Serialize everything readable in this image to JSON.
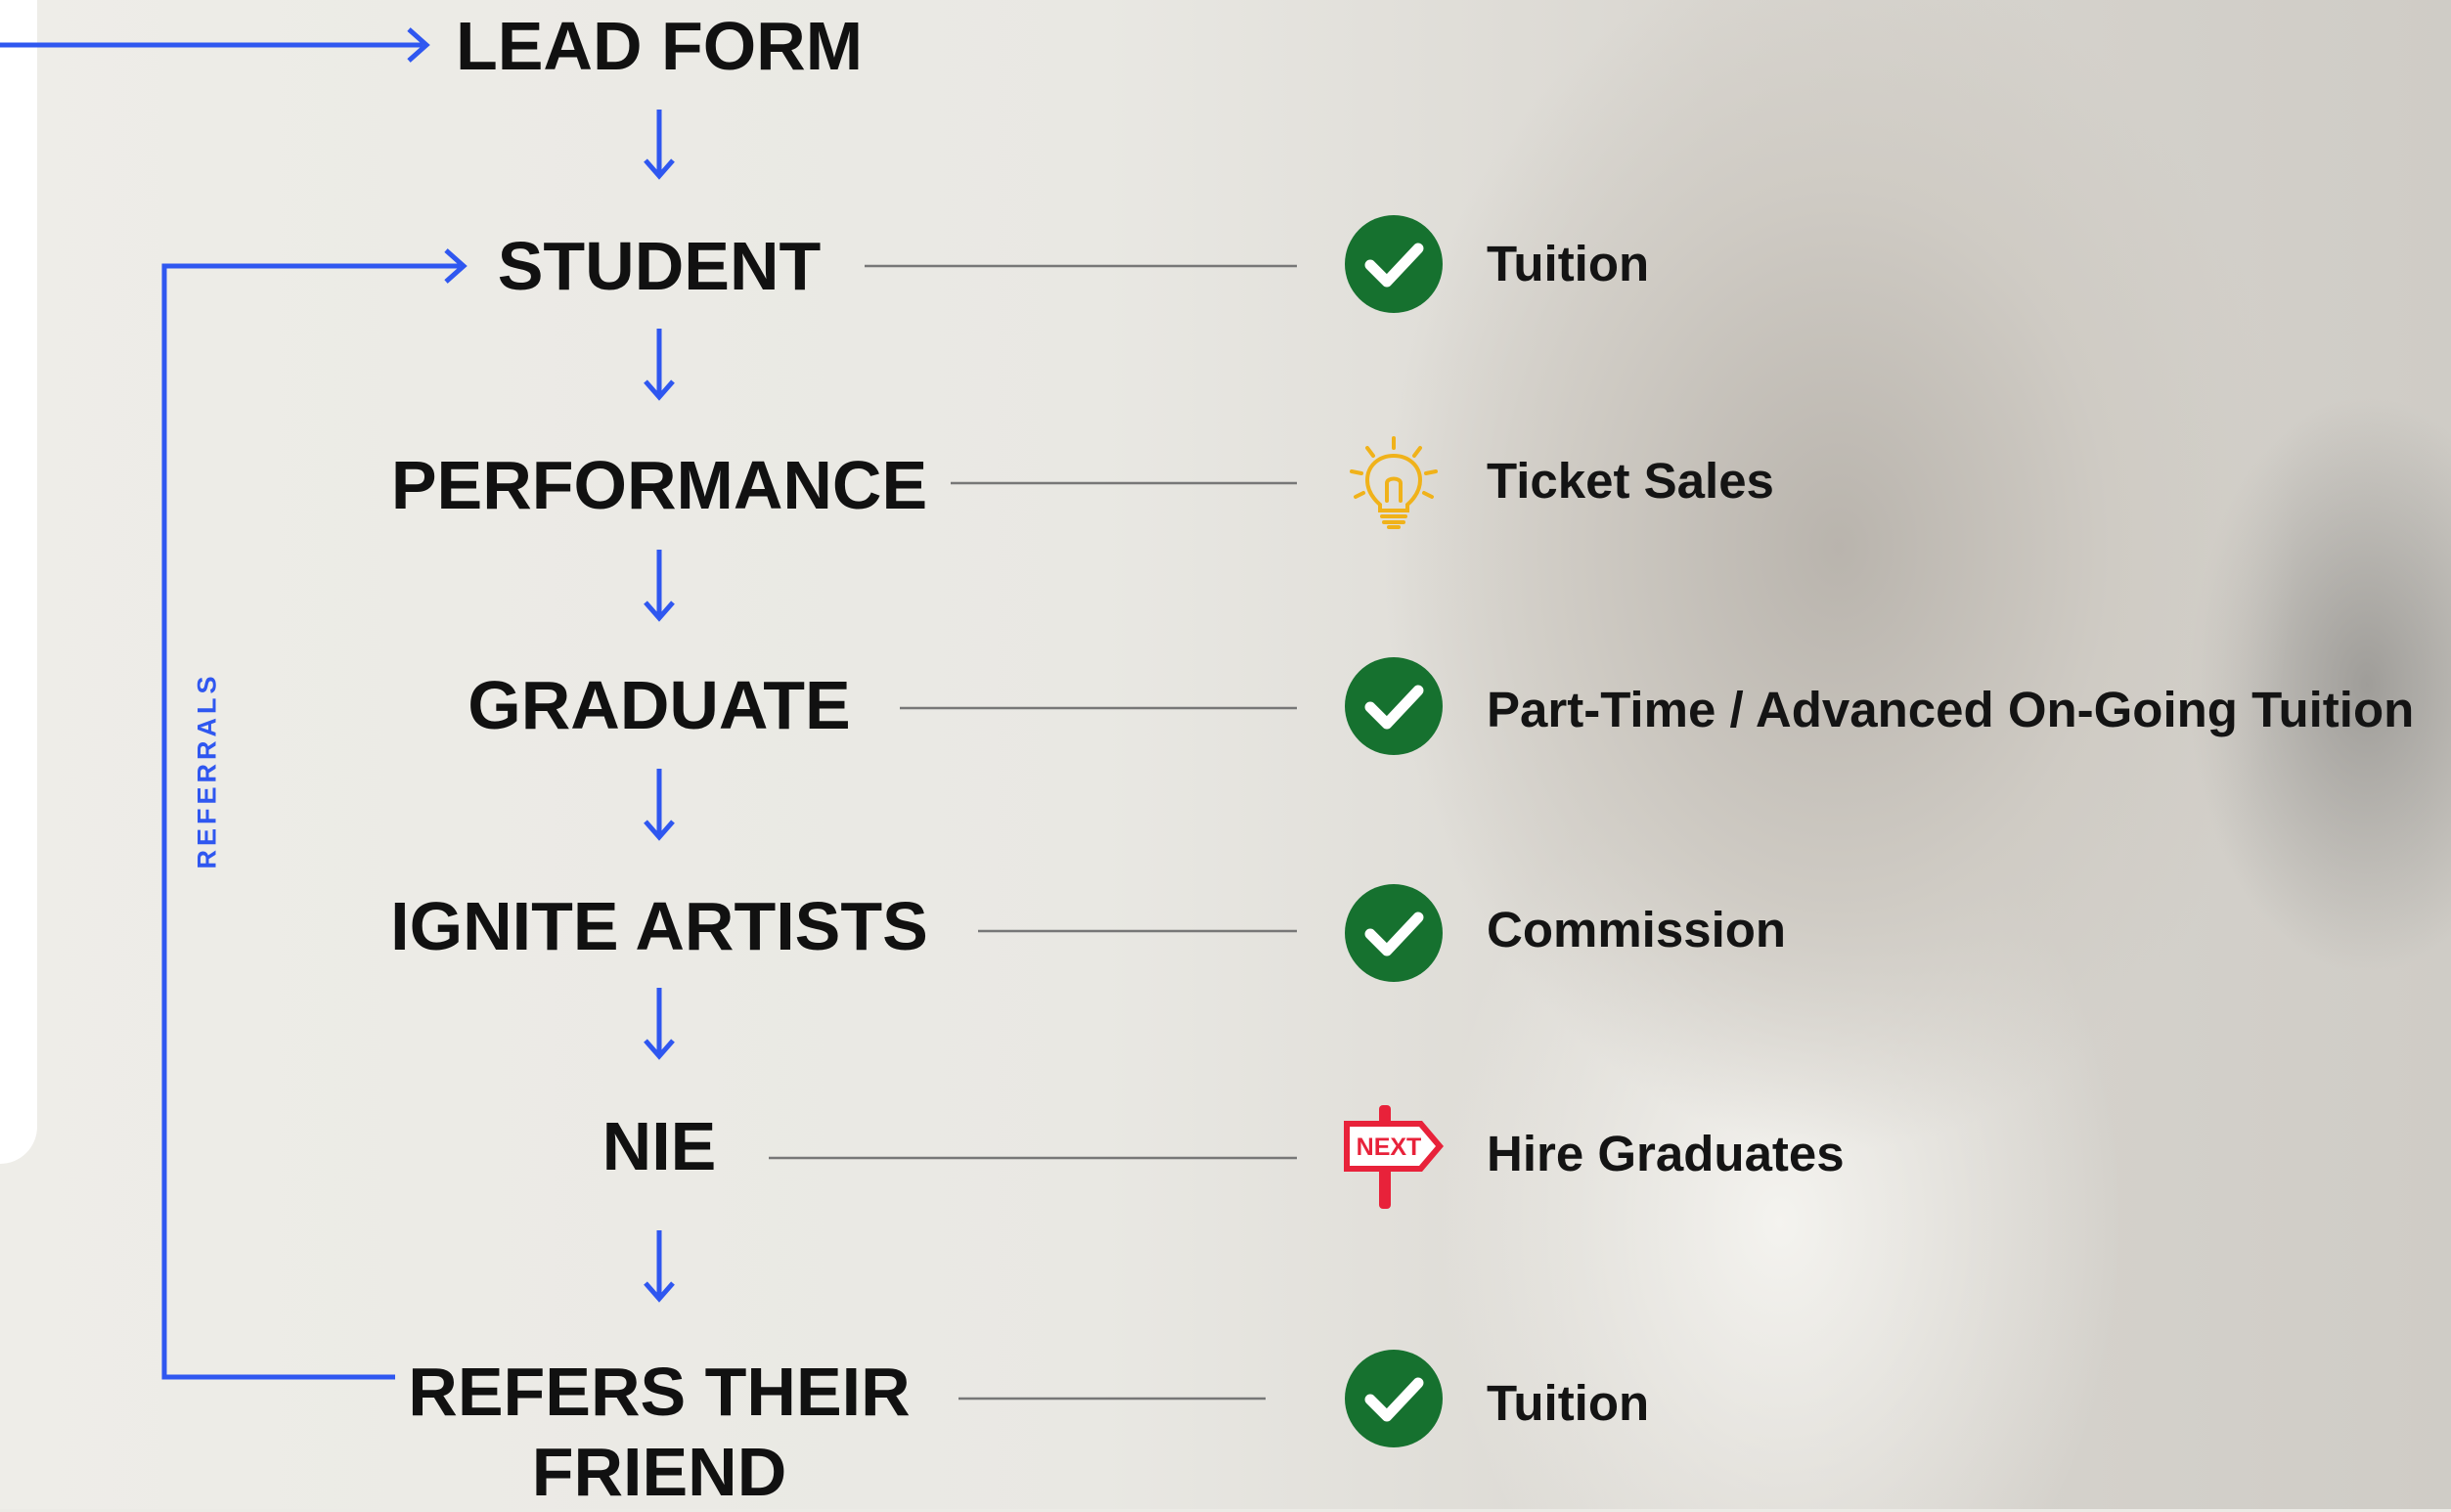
{
  "diagram": {
    "accent_color": "#2f57f0",
    "connector_color": "#777777",
    "referrals_label": "REFERRALS",
    "stages": [
      {
        "id": "lead-form",
        "label": "LEAD FORM"
      },
      {
        "id": "student",
        "label": "STUDENT"
      },
      {
        "id": "performance",
        "label": "PERFORMANCE"
      },
      {
        "id": "graduate",
        "label": "GRADUATE"
      },
      {
        "id": "ignite-artists",
        "label": "IGNITE ARTISTS"
      },
      {
        "id": "nie",
        "label": "NIE"
      },
      {
        "id": "refers-their-friend",
        "label": "REFERS THEIR FRIEND"
      }
    ],
    "outcomes": [
      {
        "stage": "student",
        "icon": "check-circle-icon",
        "label": "Tuition"
      },
      {
        "stage": "performance",
        "icon": "lightbulb-icon",
        "label": "Ticket Sales"
      },
      {
        "stage": "graduate",
        "icon": "check-circle-icon",
        "label": "Part-Time / Advanced On-Going Tuition"
      },
      {
        "stage": "ignite-artists",
        "icon": "check-circle-icon",
        "label": "Commission"
      },
      {
        "stage": "nie",
        "icon": "next-sign-icon",
        "label": "Hire Graduates"
      },
      {
        "stage": "refers-their-friend",
        "icon": "check-circle-icon",
        "label": "Tuition"
      }
    ],
    "icon_colors": {
      "check_circle": "#16712f",
      "lightbulb": "#f0b21a",
      "next_sign": "#e8223a"
    }
  }
}
